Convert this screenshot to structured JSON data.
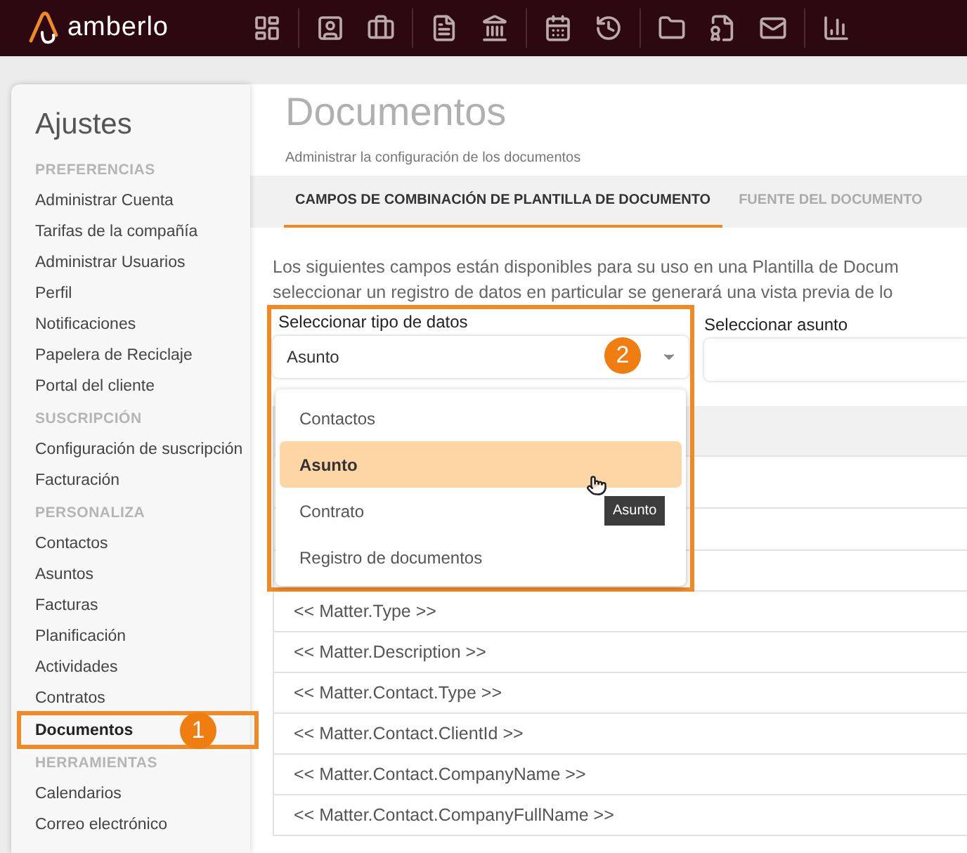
{
  "app": {
    "logo_text": "amberlo"
  },
  "sidebar": {
    "title": "Ajustes",
    "callout": "1",
    "sections": [
      {
        "heading": "PREFERENCIAS",
        "items": [
          {
            "label": "Administrar Cuenta",
            "selected": false
          },
          {
            "label": "Tarifas de la compañía",
            "selected": false
          },
          {
            "label": "Administrar Usuarios",
            "selected": false
          },
          {
            "label": "Perfil",
            "selected": false
          },
          {
            "label": "Notificaciones",
            "selected": false
          },
          {
            "label": "Papelera de Reciclaje",
            "selected": false
          },
          {
            "label": "Portal del cliente",
            "selected": false
          }
        ]
      },
      {
        "heading": "SUSCRIPCIÓN",
        "items": [
          {
            "label": "Configuración de suscripción",
            "selected": false
          },
          {
            "label": "Facturación",
            "selected": false
          }
        ]
      },
      {
        "heading": "PERSONALIZA",
        "items": [
          {
            "label": "Contactos",
            "selected": false
          },
          {
            "label": "Asuntos",
            "selected": false
          },
          {
            "label": "Facturas",
            "selected": false
          },
          {
            "label": "Planificación",
            "selected": false
          },
          {
            "label": "Actividades",
            "selected": false
          },
          {
            "label": "Contratos",
            "selected": false
          },
          {
            "label": "Documentos",
            "selected": true
          }
        ]
      },
      {
        "heading": "HERRAMIENTAS",
        "items": [
          {
            "label": "Calendarios",
            "selected": false
          },
          {
            "label": "Correo electrónico",
            "selected": false
          }
        ]
      }
    ]
  },
  "page": {
    "title": "Documentos",
    "subtitle": "Administrar la configuración de los documentos",
    "tabs": [
      {
        "label": "CAMPOS DE COMBINACIÓN DE PLANTILLA DE DOCUMENTO",
        "selected": true
      },
      {
        "label": "FUENTE DEL DOCUMENTO",
        "selected": false
      }
    ],
    "description": [
      "Los siguientes campos están disponibles para su uso en una Plantilla de Docum",
      "seleccionar un registro de datos en particular se generará una vista previa de lo"
    ],
    "data_type_select": {
      "label": "Seleccionar tipo de datos",
      "value": "Asunto",
      "callout": "2",
      "expanded": true,
      "options": [
        {
          "label": "Contactos",
          "selected": false
        },
        {
          "label": "Asunto",
          "selected": true
        },
        {
          "label": "Contrato",
          "selected": false
        },
        {
          "label": "Registro de documentos",
          "selected": false
        }
      ],
      "tooltip": "Asunto"
    },
    "record_select": {
      "label": "Seleccionar asunto"
    },
    "fields": [
      "<< Matter.Type >>",
      "<< Matter.Description >>",
      "<< Matter.Contact.Type >>",
      "<< Matter.Contact.ClientId >>",
      "<< Matter.Contact.CompanyName >>",
      "<< Matter.Contact.CompanyFullName >>"
    ]
  }
}
